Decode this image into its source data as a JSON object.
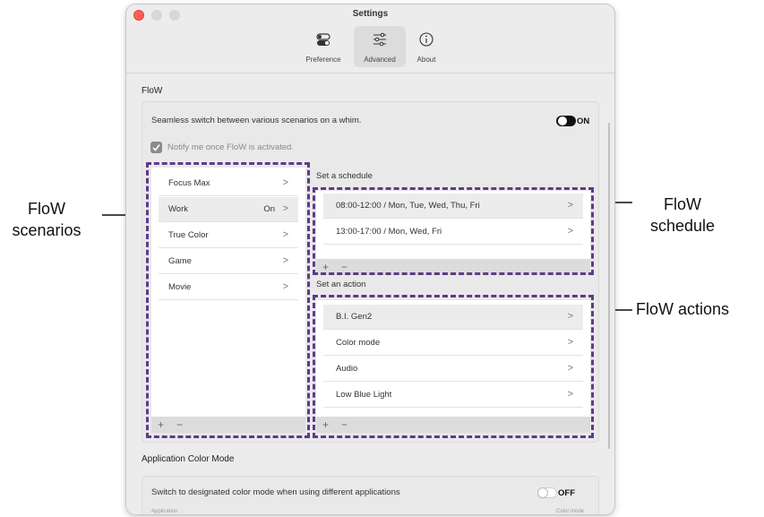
{
  "callouts": {
    "scenarios": "FloW\nscenarios",
    "schedule": "FloW\nschedule",
    "actions": "FloW actions"
  },
  "window": {
    "title": "Settings"
  },
  "toolbar": {
    "tabs": [
      {
        "label": "Preference",
        "icon": "toggles-icon"
      },
      {
        "label": "Advanced",
        "icon": "sliders-icon"
      },
      {
        "label": "About",
        "icon": "info-icon"
      }
    ],
    "active": "Advanced"
  },
  "flow": {
    "section_title": "FloW",
    "seamless_text": "Seamless switch between various scenarios on a whim.",
    "toggle_label": "ON",
    "toggle_on": true,
    "notify_text": "Notify me once FloW is activated.",
    "notify_checked": true,
    "scenarios": [
      {
        "label": "Focus Max",
        "value": ""
      },
      {
        "label": "Work",
        "value": "On"
      },
      {
        "label": "True Color",
        "value": ""
      },
      {
        "label": "Game",
        "value": ""
      },
      {
        "label": "Movie",
        "value": ""
      }
    ],
    "scenario_selected": "Work",
    "schedule_title": "Set a schedule",
    "schedules": [
      "08:00-12:00  / Mon, Tue, Wed, Thu, Fri",
      "13:00-17:00  / Mon, Wed, Fri"
    ],
    "action_title": "Set an action",
    "actions": [
      "B.I. Gen2",
      "Color mode",
      "Audio",
      "Low Blue Light"
    ],
    "add_symbol": "+",
    "remove_symbol": "−",
    "chevron": ">"
  },
  "acm": {
    "section_title": "Application Color Mode",
    "switch_text": "Switch to designated color mode when using different applications",
    "toggle_label": "OFF",
    "col_application": "Application",
    "col_color_mode": "Color mode"
  },
  "colors": {
    "highlight_dash": "#5e3a8a",
    "close_button": "#ff5f57"
  }
}
